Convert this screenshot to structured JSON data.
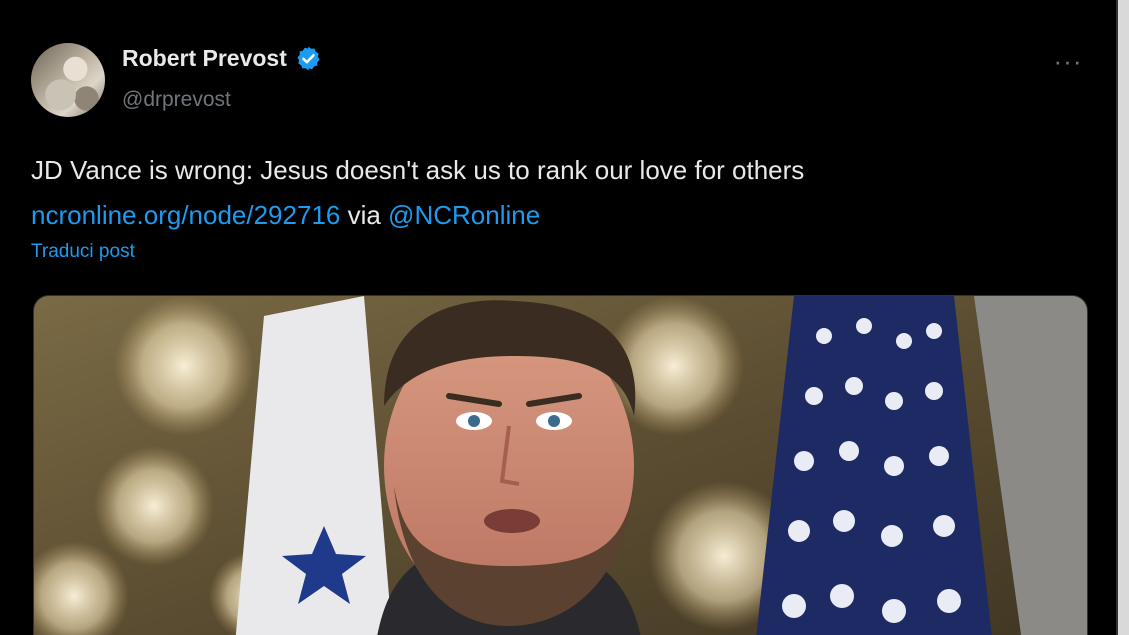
{
  "tweet": {
    "author": {
      "display_name": "Robert Prevost",
      "handle": "@drprevost",
      "verified": true,
      "avatar_icon": "profile-photo"
    },
    "more_icon": "ellipsis-icon",
    "more_label": "···",
    "text": {
      "line1": "JD Vance is wrong: Jesus doesn't ask us to rank our love for others",
      "link": "ncronline.org/node/292716",
      "via": " via ",
      "mention": "@NCRonline"
    },
    "translate_label": "Traduci post",
    "media": {
      "type": "photo",
      "subject": "man-speaking-in-front-of-flags"
    }
  },
  "colors": {
    "background": "#000000",
    "text_primary": "#e7e9ea",
    "text_secondary": "#71767b",
    "accent": "#1d9bf0"
  }
}
